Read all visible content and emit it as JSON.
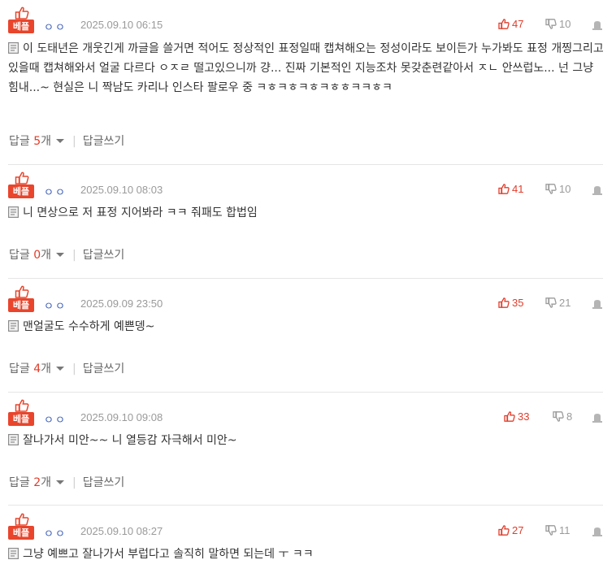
{
  "best_label": "베플",
  "reply_label": "답글",
  "reply_unit": "개",
  "write_reply_label": "답글쓰기",
  "separator": "|",
  "comments": [
    {
      "author": "ㅇㅇ",
      "date": "2025.09.10 06:15",
      "likes": "47",
      "dislikes": "10",
      "text": "이 도태년은 개웃긴게 까글을 쓸거면 적어도 정상적인 표정일때 캡쳐해오는 정성이라도 보이든가 누가봐도 표정 개찡그리고있을때 캡쳐해와서 얼굴 다르다 ㅇㅈㄹ 떨고있으니까 걍... 진짜 기본적인 지능조차 못갖춘련같아서 ㅈㄴ 안쓰럽노... 넌 그냥 힘내...~ 현실은 니 짝남도 카리나 인스타 팔로우 중 ㅋㅎㅋㅎㅋㅎㅋㅎㅎㅋㅋㅎㅋ",
      "reply_count": "5"
    },
    {
      "author": "ㅇㅇ",
      "date": "2025.09.10 08:03",
      "likes": "41",
      "dislikes": "10",
      "text": "니 면상으로 저 표정 지어봐라 ㅋㅋ 줘패도 합법임",
      "reply_count": "0"
    },
    {
      "author": "ㅇㅇ",
      "date": "2025.09.09 23:50",
      "likes": "35",
      "dislikes": "21",
      "text": "맨얼굴도 수수하게 예쁜뎅~",
      "reply_count": "4"
    },
    {
      "author": "ㅇㅇ",
      "date": "2025.09.10 09:08",
      "likes": "33",
      "dislikes": "8",
      "text": "잘나가서 미안~~ 니 열등감 자극해서 미안~",
      "reply_count": "2"
    },
    {
      "author": "ㅇㅇ",
      "date": "2025.09.10 08:27",
      "likes": "27",
      "dislikes": "11",
      "text": "그냥 예쁘고 잘나가서 부럽다고 솔직히 말하면 되는데 ㅜ ㅋㅋ",
      "reply_count": ""
    }
  ],
  "colors": {
    "accent_red": "#e8452c",
    "author_blue": "#3a5cb4",
    "muted": "#9a9a9a"
  },
  "icons": [
    "best-thumb-icon",
    "thumbs-up-icon",
    "thumbs-down-icon",
    "report-icon",
    "memo-icon",
    "caret-down-icon"
  ]
}
